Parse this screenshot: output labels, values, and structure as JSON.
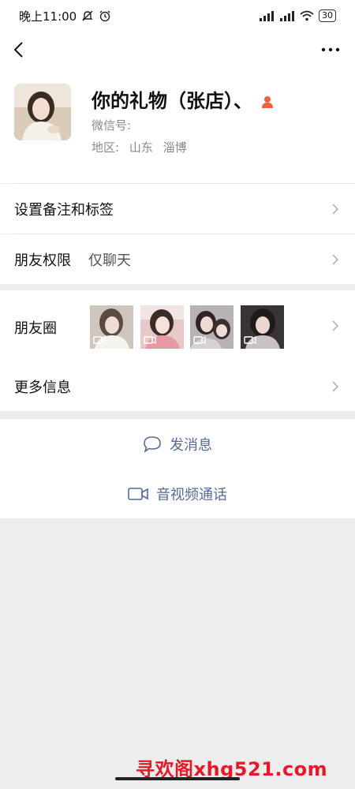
{
  "status_bar": {
    "time": "晚上11:00",
    "battery": "30"
  },
  "profile": {
    "nickname": "你的礼物（张店）、",
    "wechat_id_label": "微信号:",
    "region_label": "地区:",
    "region_province": "山东",
    "region_city": "淄博"
  },
  "rows": {
    "remark": "设置备注和标签",
    "permission_label": "朋友权限",
    "permission_value": "仅聊天",
    "moments": "朋友圈",
    "more_info": "更多信息"
  },
  "actions": {
    "message": "发消息",
    "call": "音视频通话"
  },
  "watermark": "寻欢阁xhg521.com",
  "colors": {
    "link": "#576b95",
    "gender_icon": "#e8623c",
    "watermark": "#e8182a",
    "background": "#ededed"
  },
  "icons": {
    "back": "chevron-left-icon",
    "more": "more-dots-icon",
    "message": "chat-bubble-icon",
    "call": "video-camera-icon",
    "gender": "person-icon"
  }
}
